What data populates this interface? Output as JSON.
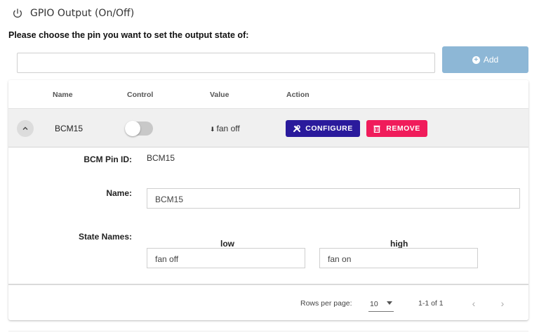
{
  "header": {
    "title": "GPIO Output (On/Off)",
    "icon": "power-icon"
  },
  "prompt": "Please choose the pin you want to set the output state of:",
  "pin_select": {
    "value": "",
    "placeholder": ""
  },
  "add_button": {
    "label": "Add",
    "icon": "plus-circle-icon",
    "color": "#8db7d6"
  },
  "table": {
    "columns": [
      "Name",
      "Control",
      "Value",
      "Action"
    ],
    "rows": [
      {
        "name": "BCM15",
        "control_on": false,
        "value": "fan off",
        "value_icon": "arrow-down-icon",
        "configure_label": "CONFIGURE",
        "remove_label": "REMOVE",
        "expanded": true
      }
    ],
    "detail": {
      "pin_id_label": "BCM Pin ID:",
      "pin_id_value": "BCM15",
      "name_label": "Name:",
      "name_value": "BCM15",
      "state_names_label": "State Names:",
      "low_header": "low",
      "high_header": "high",
      "low_value": "fan off",
      "high_value": "fan on"
    },
    "pagination": {
      "rows_per_page_label": "Rows per page:",
      "rows_per_page_value": "10",
      "range_text": "1-1 of 1"
    }
  },
  "colors": {
    "configure": "#2a1a9c",
    "remove": "#f01c5b",
    "row_highlight": "#f0f0f0"
  }
}
